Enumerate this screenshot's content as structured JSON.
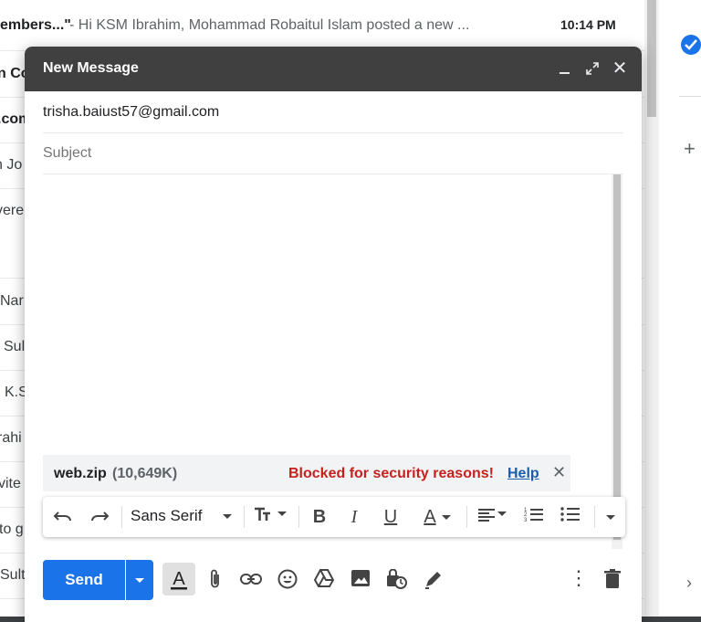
{
  "inbox": {
    "row0": {
      "sender": "embers...\"",
      "snippet": "- Hi KSM Ibrahim, Mohammad Robaitul Islam posted a new ...",
      "time": "10:14 PM"
    },
    "fragments": [
      "n Co",
      ".com",
      "n Jo",
      "vere",
      "Nar",
      "Sul",
      "K.S",
      "rahi",
      "vite",
      "to g",
      "Sult"
    ]
  },
  "compose": {
    "title": "New Message",
    "to": "trisha.baiust57@gmail.com",
    "subject_placeholder": "Subject",
    "attachment": {
      "name": "web.zip",
      "size": "(10,649K)",
      "status": "Blocked for security reasons!",
      "help": "Help"
    },
    "format_bar": {
      "font": "Sans Serif"
    },
    "send_label": "Send"
  },
  "icons": [
    "minimize-icon",
    "fullscreen-icon",
    "close-icon",
    "undo-icon",
    "redo-icon",
    "text-size-icon",
    "bold-icon",
    "italic-icon",
    "underline-icon",
    "text-color-icon",
    "align-icon",
    "numbered-list-icon",
    "bulleted-list-icon",
    "more-formatting-icon",
    "formatting-options-icon",
    "attach-icon",
    "link-icon",
    "emoji-icon",
    "drive-icon",
    "photo-icon",
    "confidential-icon",
    "signature-icon",
    "more-options-icon",
    "discard-icon"
  ],
  "colors": {
    "header": "#404040",
    "send": "#1a73e8",
    "blocked": "#c5221f",
    "help_link": "#1a5dab"
  }
}
